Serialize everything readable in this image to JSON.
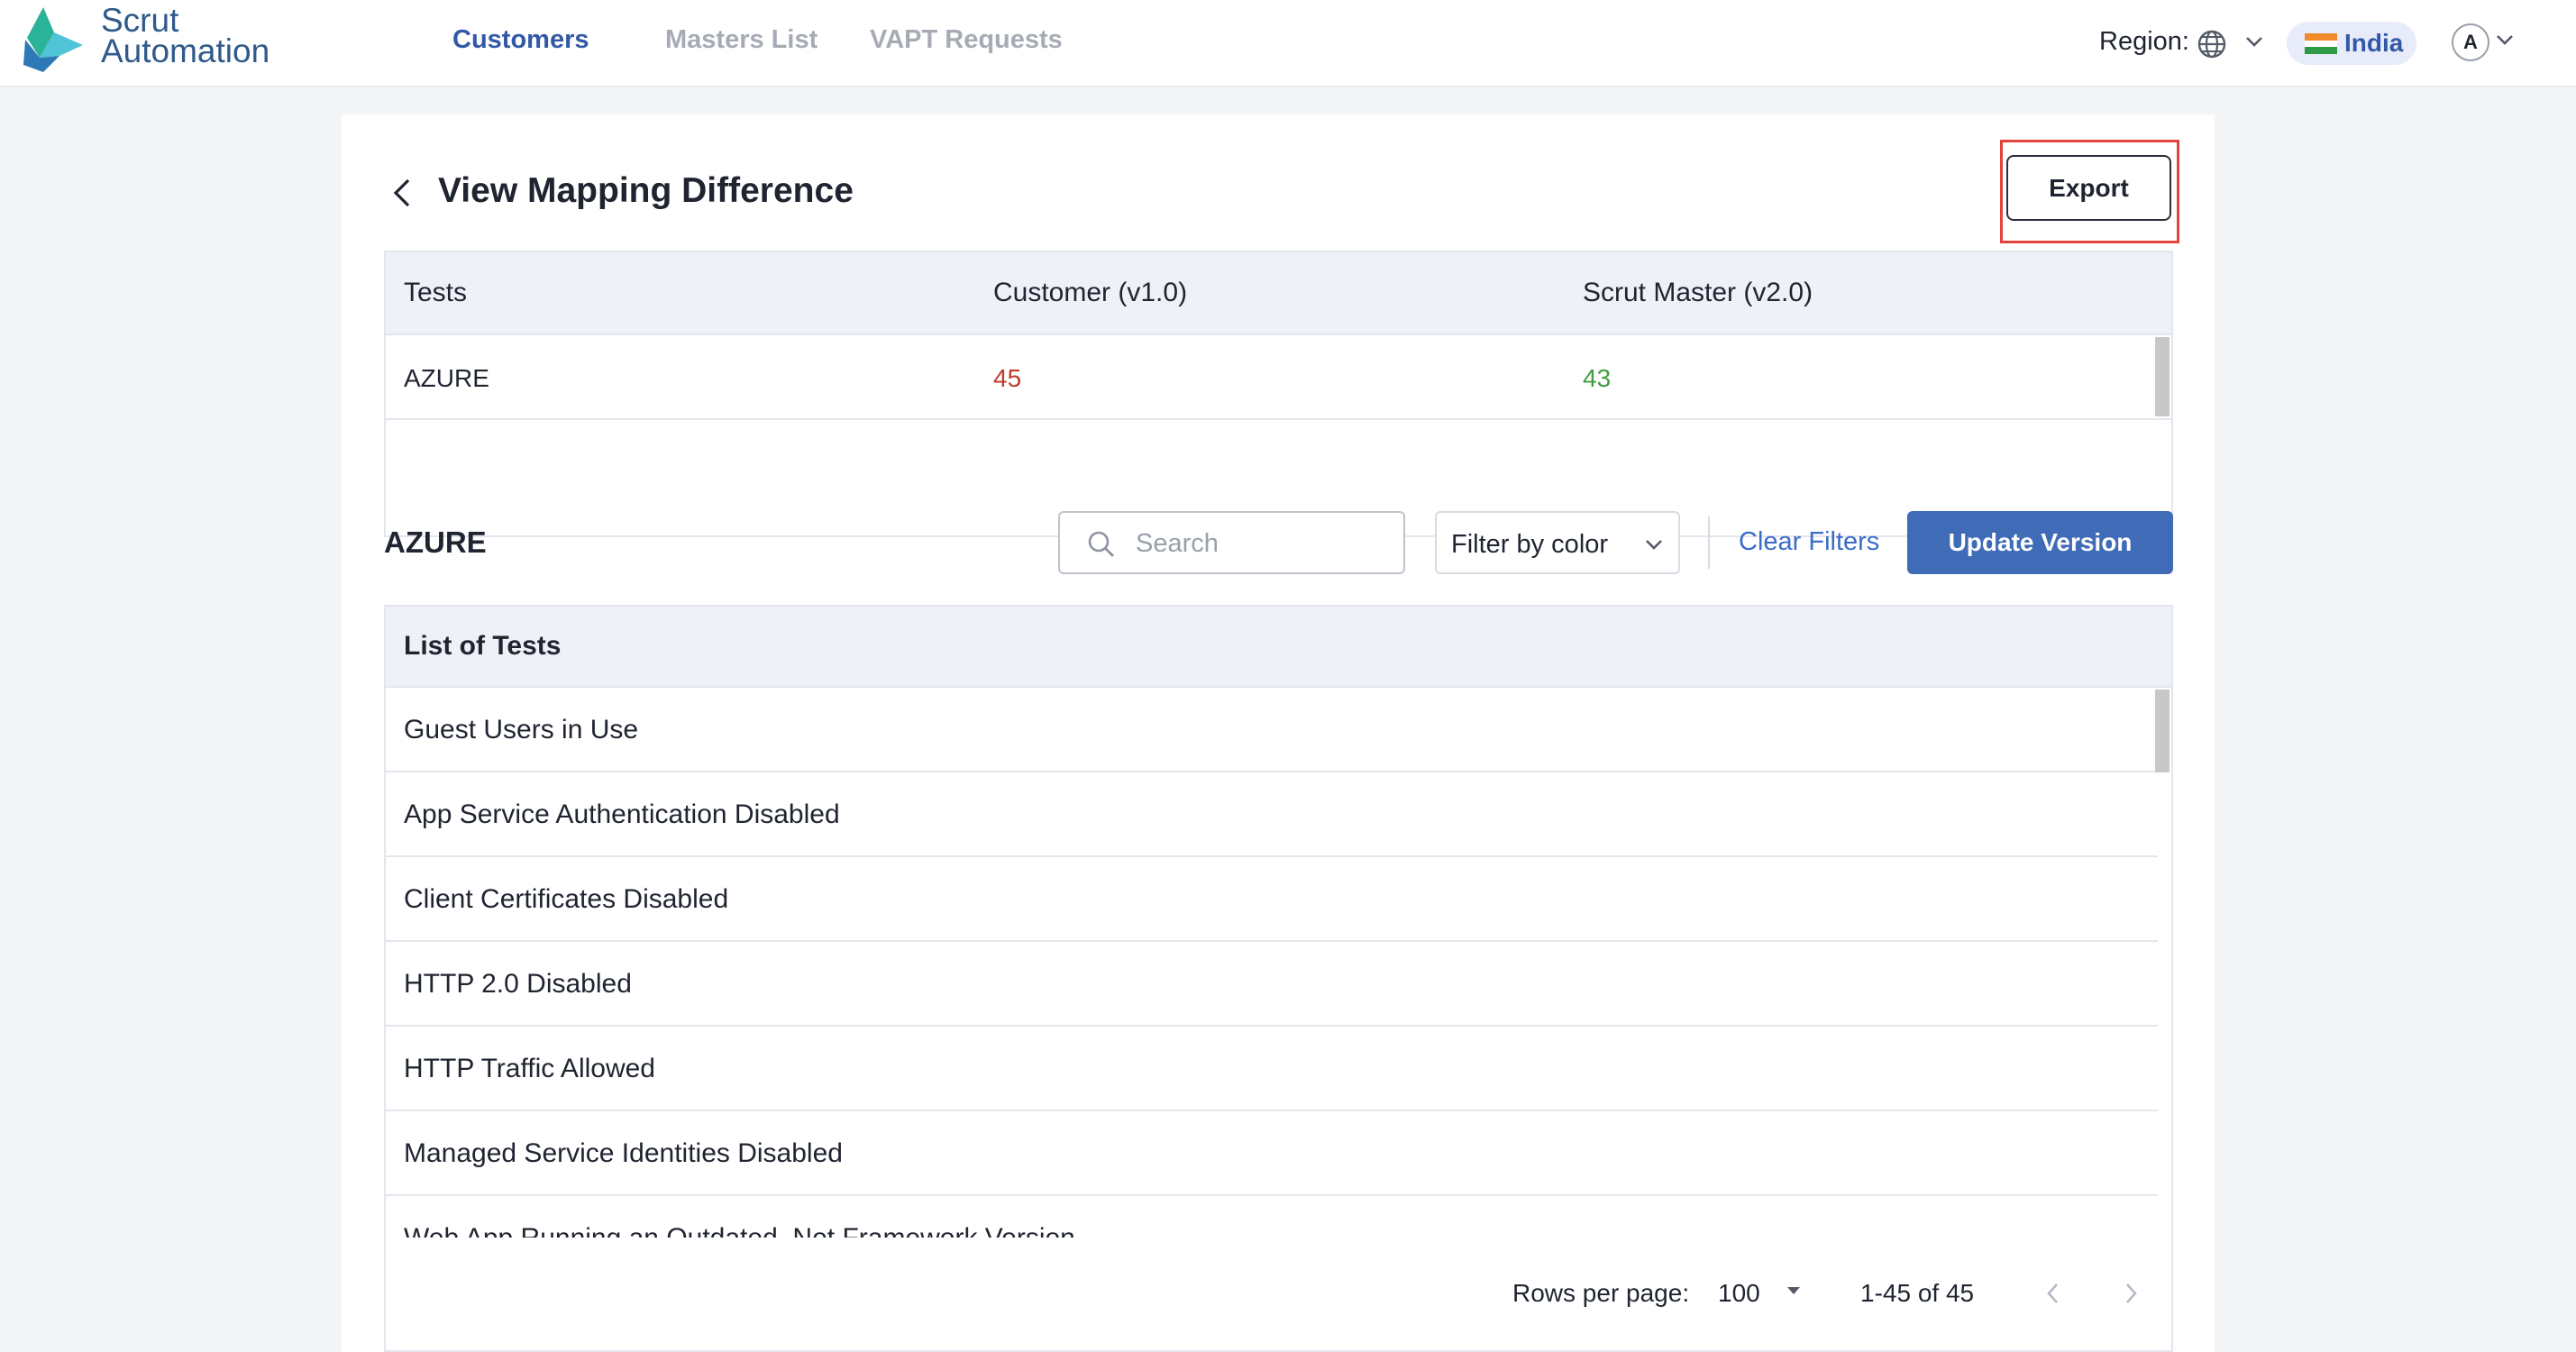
{
  "brand": {
    "name_line1": "Scrut",
    "name_line2": "Automation"
  },
  "nav": {
    "tabs": [
      {
        "label": "Customers",
        "active": true
      },
      {
        "label": "Masters List"
      },
      {
        "label": "VAPT Requests"
      }
    ]
  },
  "region": {
    "label": "Region:",
    "selected": "India"
  },
  "user": {
    "avatar_initial": "A"
  },
  "page": {
    "title": "View Mapping Difference",
    "export_label": "Export"
  },
  "summary": {
    "headers": [
      "Tests",
      "Customer (v1.0)",
      "Scrut Master (v2.0)"
    ],
    "rows": [
      {
        "name": "AZURE",
        "customer": "45",
        "master": "43"
      }
    ],
    "colors": {
      "customer": "#c0392b",
      "master": "#3f9d3f"
    }
  },
  "section": {
    "title": "AZURE",
    "search_placeholder": "Search",
    "filter_label": "Filter by color",
    "clear_filters_label": "Clear Filters",
    "update_label": "Update Version"
  },
  "tests": {
    "header": "List of Tests",
    "items": [
      "Guest Users in Use",
      "App Service Authentication Disabled",
      "Client Certificates Disabled",
      "HTTP 2.0 Disabled",
      "HTTP Traffic Allowed",
      "Managed Service Identities Disabled",
      "Web App Running an Outdated .Net Framework Version"
    ]
  },
  "pagination": {
    "rows_per_page_label": "Rows per page:",
    "rows_per_page": "100",
    "range": "1-45 of 45"
  },
  "theme": {
    "accent": "#3f6bb7",
    "nav_active": "#3259a8",
    "highlight": "#e0443a"
  }
}
